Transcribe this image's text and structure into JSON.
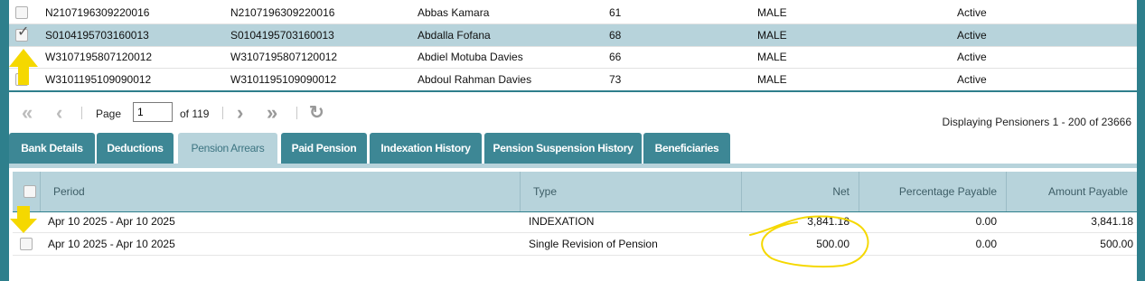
{
  "pensioners": {
    "rows": [
      {
        "id": "N2107196309220016",
        "id2": "N2107196309220016",
        "name": "Abbas Kamara",
        "age": "61",
        "gender": "MALE",
        "status": "Active",
        "selected": false
      },
      {
        "id": "S0104195703160013",
        "id2": "S0104195703160013",
        "name": "Abdalla Fofana",
        "age": "68",
        "gender": "MALE",
        "status": "Active",
        "selected": true
      },
      {
        "id": "W3107195807120012",
        "id2": "W3107195807120012",
        "name": "Abdiel Motuba Davies",
        "age": "66",
        "gender": "MALE",
        "status": "Active",
        "selected": false
      },
      {
        "id": "W3101195109090012",
        "id2": "W3101195109090012",
        "name": "Abdoul Rahman Davies",
        "age": "73",
        "gender": "MALE",
        "status": "Active",
        "selected": false
      }
    ]
  },
  "pager": {
    "first_icon": "first-page-icon",
    "prev_icon": "prev-page-icon",
    "next_icon": "next-page-icon",
    "last_icon": "last-page-icon",
    "refresh_icon": "refresh-icon",
    "page_label": "Page",
    "page_value": "1",
    "of_label": "of 119",
    "display_text": "Displaying Pensioners 1 - 200 of 23666"
  },
  "tabs": [
    {
      "label": "Bank Details",
      "active": false
    },
    {
      "label": "Deductions",
      "active": false
    },
    {
      "label": "Pension Arrears",
      "active": true
    },
    {
      "label": "Paid Pension",
      "active": false
    },
    {
      "label": "Indexation History",
      "active": false
    },
    {
      "label": "Pension Suspension History",
      "active": false
    },
    {
      "label": "Beneficiaries",
      "active": false
    }
  ],
  "arrears": {
    "headers": {
      "period": "Period",
      "type": "Type",
      "net": "Net",
      "percentage_payable": "Percentage Payable",
      "amount_payable": "Amount Payable"
    },
    "rows": [
      {
        "period": "Apr 10 2025 - Apr 10 2025",
        "type": "INDEXATION",
        "net": "3,841.18",
        "percentage_payable": "0.00",
        "amount_payable": "3,841.18"
      },
      {
        "period": "Apr 10 2025 - Apr 10 2025",
        "type": "Single Revision of Pension",
        "net": "500.00",
        "percentage_payable": "0.00",
        "amount_payable": "500.00"
      }
    ]
  },
  "colors": {
    "teal": "#3d8795",
    "light_teal": "#b7d3db",
    "annotation_yellow": "#f5d800"
  }
}
